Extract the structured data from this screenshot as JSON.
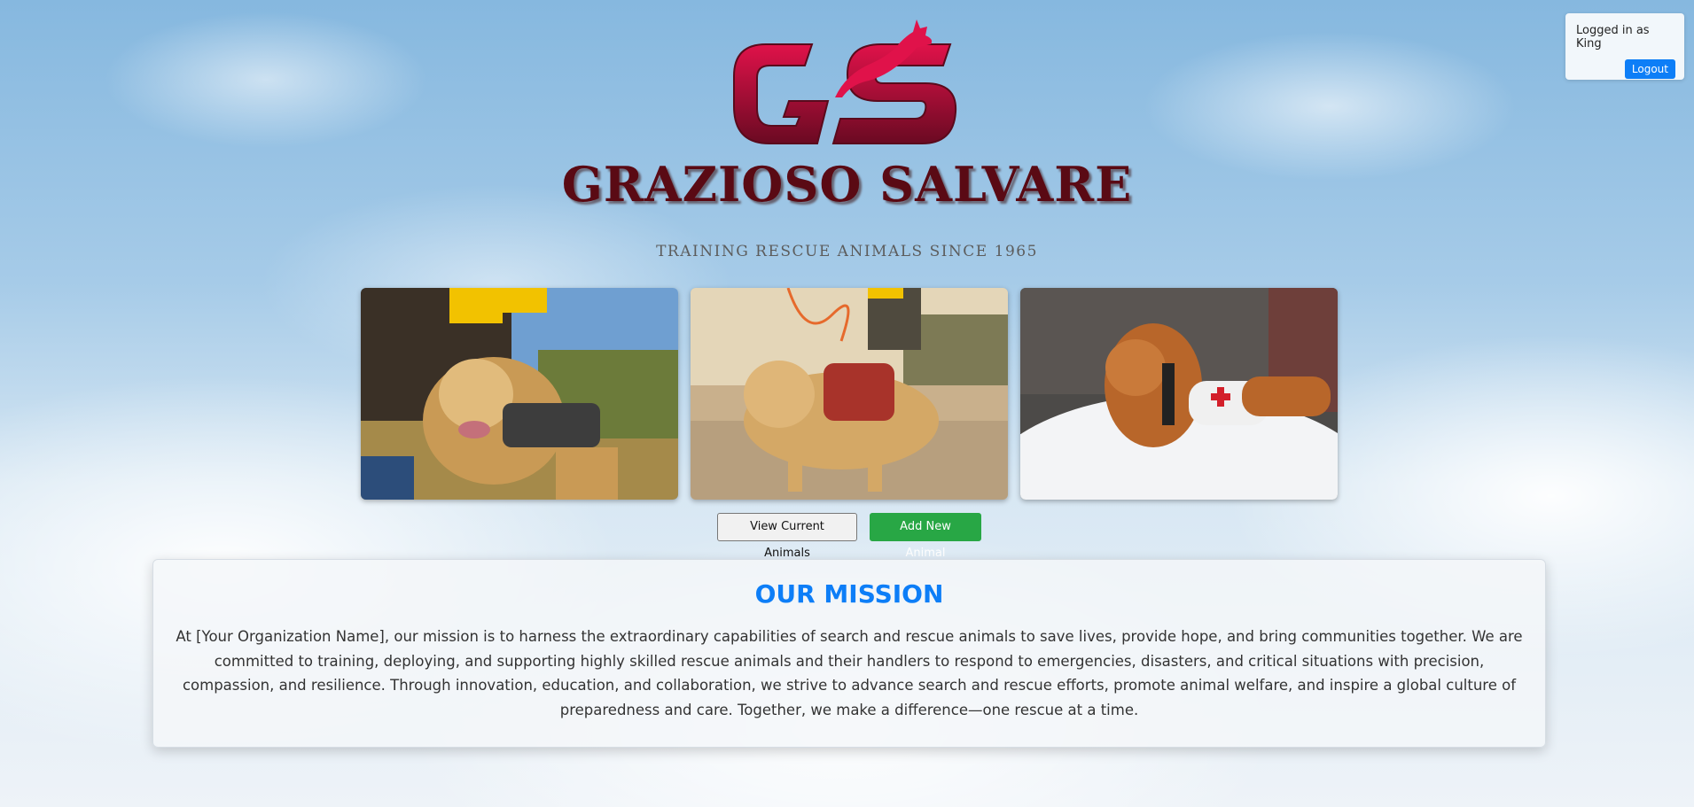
{
  "brand": {
    "name": "GRAZIOSO SALVARE",
    "tagline": "TRAINING RESCUE ANIMALS SINCE 1965",
    "logo_letters": "GS",
    "logo_color": "#c8103e"
  },
  "session": {
    "status_text": "Logged in as King",
    "logout_label": "Logout"
  },
  "photos": [
    {
      "subject": "golden retriever in harness with handlers"
    },
    {
      "subject": "golden retriever in red harness on trail"
    },
    {
      "subject": "golden retriever rescue dog in snow"
    }
  ],
  "actions": {
    "view_label": "View Current Animals",
    "add_label": "Add New Animal"
  },
  "mission": {
    "title": "OUR MISSION",
    "text": "At [Your Organization Name], our mission is to harness the extraordinary capabilities of search and rescue animals to save lives, provide hope, and bring communities together. We are committed to training, deploying, and supporting highly skilled rescue animals and their handlers to respond to emergencies, disasters, and critical situations with precision, compassion, and resilience. Through innovation, education, and collaboration, we strive to advance search and rescue efforts, promote animal welfare, and inspire a global culture of preparedness and care. Together, we make a difference—one rescue at a time."
  },
  "colors": {
    "accent": "#0d7ef7",
    "success": "#28a745",
    "brand_dark": "#5a0a14"
  }
}
